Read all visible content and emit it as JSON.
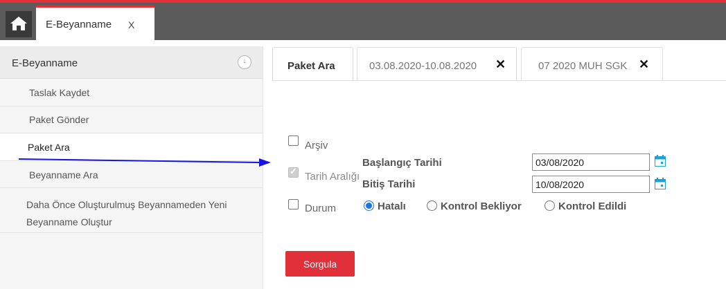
{
  "topbar": {
    "tab_label": "E-Beyanname",
    "tab_close": "X",
    "home_icon": "home-icon",
    "accent": "#e0303a"
  },
  "sidebar": {
    "title": "E-Beyanname",
    "collapse_icon": "arrow-down-icon",
    "collapse_glyph": "↓",
    "items": [
      {
        "label": "Taslak Kaydet"
      },
      {
        "label": "Paket Gönder"
      },
      {
        "label": "Paket Ara",
        "active": true
      },
      {
        "label": "Beyanname Ara"
      },
      {
        "label": "Daha Önce Oluşturulmuş Beyannameden Yeni Beyanname Oluştur"
      }
    ]
  },
  "tabs": [
    {
      "label": "Paket Ara",
      "active": true
    },
    {
      "label": "03.08.2020-10.08.2020",
      "close": "✕"
    },
    {
      "label": "07 2020 MUH SGK",
      "close": "✕"
    }
  ],
  "form": {
    "arsiv": {
      "label": "Arşiv",
      "checked": false
    },
    "tarih_araligi": {
      "label": "Tarih Aralığı",
      "checked": true,
      "disabled": true
    },
    "baslangic": {
      "label": "Başlangıç Tarihi",
      "value": "03/08/2020"
    },
    "bitis": {
      "label": "Bitiş Tarihi",
      "value": "10/08/2020"
    },
    "durum": {
      "label": "Durum",
      "checked": false
    },
    "radios": [
      {
        "label": "Hatalı",
        "selected": true
      },
      {
        "label": "Kontrol Bekliyor",
        "selected": false
      },
      {
        "label": "Kontrol Edildi",
        "selected": false
      }
    ],
    "submit": "Sorgula",
    "calendar_icon": "calendar-icon"
  },
  "annotation": {
    "arrow_color": "#1515e0"
  }
}
